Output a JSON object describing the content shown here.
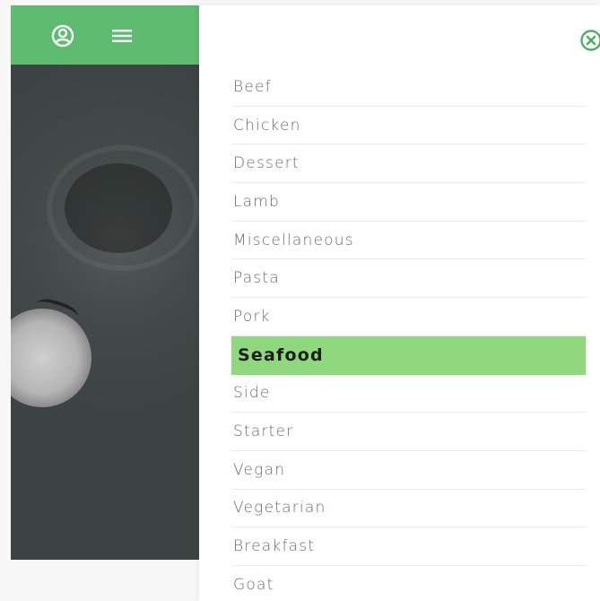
{
  "colors": {
    "header_green": "#5ebc71",
    "active_green": "#8fd87e",
    "close_green": "#4caf63"
  },
  "header": {
    "user_icon": "user-circle-icon",
    "menu_icon": "hamburger-menu-icon"
  },
  "drawer": {
    "close_icon": "close-circle-icon",
    "selected": "Seafood",
    "categories": [
      {
        "label": "Beef"
      },
      {
        "label": "Chicken"
      },
      {
        "label": "Dessert"
      },
      {
        "label": "Lamb"
      },
      {
        "label": "Miscellaneous"
      },
      {
        "label": "Pasta"
      },
      {
        "label": "Pork"
      },
      {
        "label": "Seafood"
      },
      {
        "label": "Side"
      },
      {
        "label": "Starter"
      },
      {
        "label": "Vegan"
      },
      {
        "label": "Vegetarian"
      },
      {
        "label": "Breakfast"
      },
      {
        "label": "Goat"
      }
    ]
  }
}
